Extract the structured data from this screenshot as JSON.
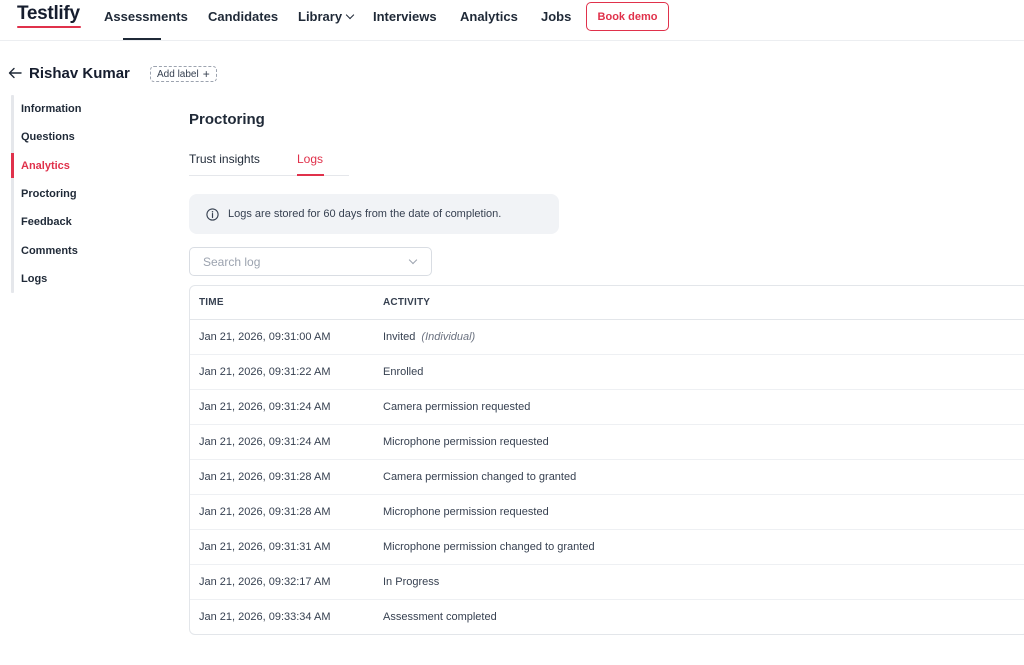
{
  "brand": {
    "logo_text": "Testlify",
    "accent_color": "#e0314b"
  },
  "nav": {
    "items": [
      {
        "label": "Assessments",
        "active": true
      },
      {
        "label": "Candidates"
      },
      {
        "label": "Library",
        "has_dropdown": true
      },
      {
        "label": "Interviews"
      },
      {
        "label": "Analytics"
      },
      {
        "label": "Jobs"
      }
    ],
    "cta_label": "Book demo"
  },
  "candidate": {
    "name": "Rishav Kumar",
    "add_label": "Add label"
  },
  "sidebar": {
    "items": [
      {
        "label": "Information"
      },
      {
        "label": "Questions"
      },
      {
        "label": "Analytics",
        "active": true
      },
      {
        "label": "Proctoring"
      },
      {
        "label": "Feedback"
      },
      {
        "label": "Comments"
      },
      {
        "label": "Logs"
      }
    ]
  },
  "main": {
    "title": "Proctoring",
    "tabs": [
      {
        "label": "Trust insights"
      },
      {
        "label": "Logs",
        "active": true
      }
    ],
    "info_text": "Logs are stored for 60 days from the date of completion.",
    "search_placeholder": "Search log"
  },
  "table": {
    "headers": {
      "time": "TIME",
      "activity": "ACTIVITY"
    },
    "rows": [
      {
        "time": "Jan 21, 2026, 09:31:00 AM",
        "activity": "Invited",
        "note": "(Individual)"
      },
      {
        "time": "Jan 21, 2026, 09:31:22 AM",
        "activity": "Enrolled",
        "note": ""
      },
      {
        "time": "Jan 21, 2026, 09:31:24 AM",
        "activity": "Camera permission requested",
        "note": ""
      },
      {
        "time": "Jan 21, 2026, 09:31:24 AM",
        "activity": "Microphone permission requested",
        "note": ""
      },
      {
        "time": "Jan 21, 2026, 09:31:28 AM",
        "activity": "Camera permission changed to granted",
        "note": ""
      },
      {
        "time": "Jan 21, 2026, 09:31:28 AM",
        "activity": "Microphone permission requested",
        "note": ""
      },
      {
        "time": "Jan 21, 2026, 09:31:31 AM",
        "activity": "Microphone permission changed to granted",
        "note": ""
      },
      {
        "time": "Jan 21, 2026, 09:32:17 AM",
        "activity": "In Progress",
        "note": ""
      },
      {
        "time": "Jan 21, 2026, 09:33:34 AM",
        "activity": "Assessment completed",
        "note": ""
      }
    ]
  }
}
